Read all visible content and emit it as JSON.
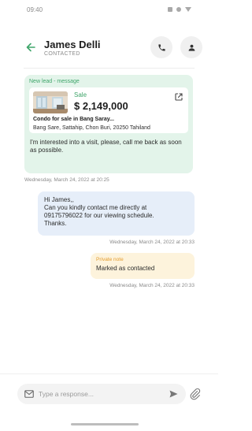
{
  "status_bar": {
    "time": "09:40"
  },
  "header": {
    "contact_name": "James Delli",
    "contact_status": "CONTACTED",
    "icons": {
      "back": "arrow-left-icon",
      "call": "phone-icon",
      "profile": "user-icon"
    }
  },
  "lead": {
    "label": "New lead - message",
    "property": {
      "type": "Sale",
      "price": "$ 2,149,000",
      "title": "Condo for sale in Bang Saray...",
      "address": "Bang Sare, Sattahip, Chon Buri, 20250 Tahiland"
    },
    "message": "I'm interested into a visit, please, call me back as soon as possible.",
    "timestamp": "Wednesday, March 24, 2022 at 20:25"
  },
  "outgoing": {
    "lines": [
      "Hi James,,",
      "Can you kindly contact me directly at",
      "09175796022 for our viewing schedule.",
      "Thanks."
    ],
    "timestamp": "Wednesday, March 24, 2022 at 20:33"
  },
  "note": {
    "label": "Private note",
    "text": "Marked as contacted",
    "timestamp": "Wednesday, March 24, 2022 at 20:33"
  },
  "composer": {
    "placeholder": "Type a response..."
  },
  "colors": {
    "accent_green": "#3fa56a",
    "lead_bg": "#e3f4ea",
    "outgoing_bg": "#e6eef9",
    "note_bg": "#fdf3dc",
    "note_label": "#e39b2d"
  }
}
